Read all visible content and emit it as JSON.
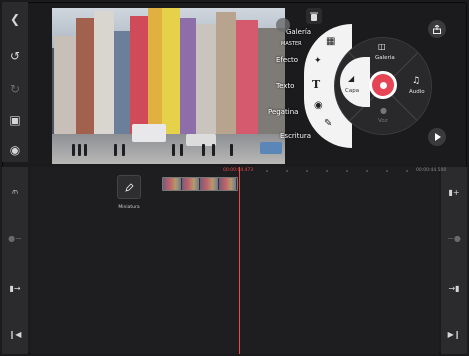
{
  "left_toolbar": {
    "icons": [
      "back-icon",
      "undo-icon",
      "redo-icon",
      "fullscreen-icon",
      "snapshot-icon"
    ]
  },
  "preview": {
    "overlay_labels": {
      "galeria": "Galería",
      "master": "MASTER",
      "efecto": "Efecto",
      "texto": "Texto",
      "pegatina": "Pegatina",
      "escritura": "Escritura"
    }
  },
  "radial_menu": {
    "galeria": "Galeria",
    "capa": "Capa",
    "audio": "Audio",
    "voz": "Voz"
  },
  "timeline": {
    "current_time": "00:00:04.473",
    "end_time": "00:00:44.500",
    "thumbnail_label": "Miniatura"
  },
  "colors": {
    "accent": "#e64555",
    "playhead": "#e94a4a",
    "panel": "#2b2b2d",
    "background": "#1b1b1d"
  }
}
